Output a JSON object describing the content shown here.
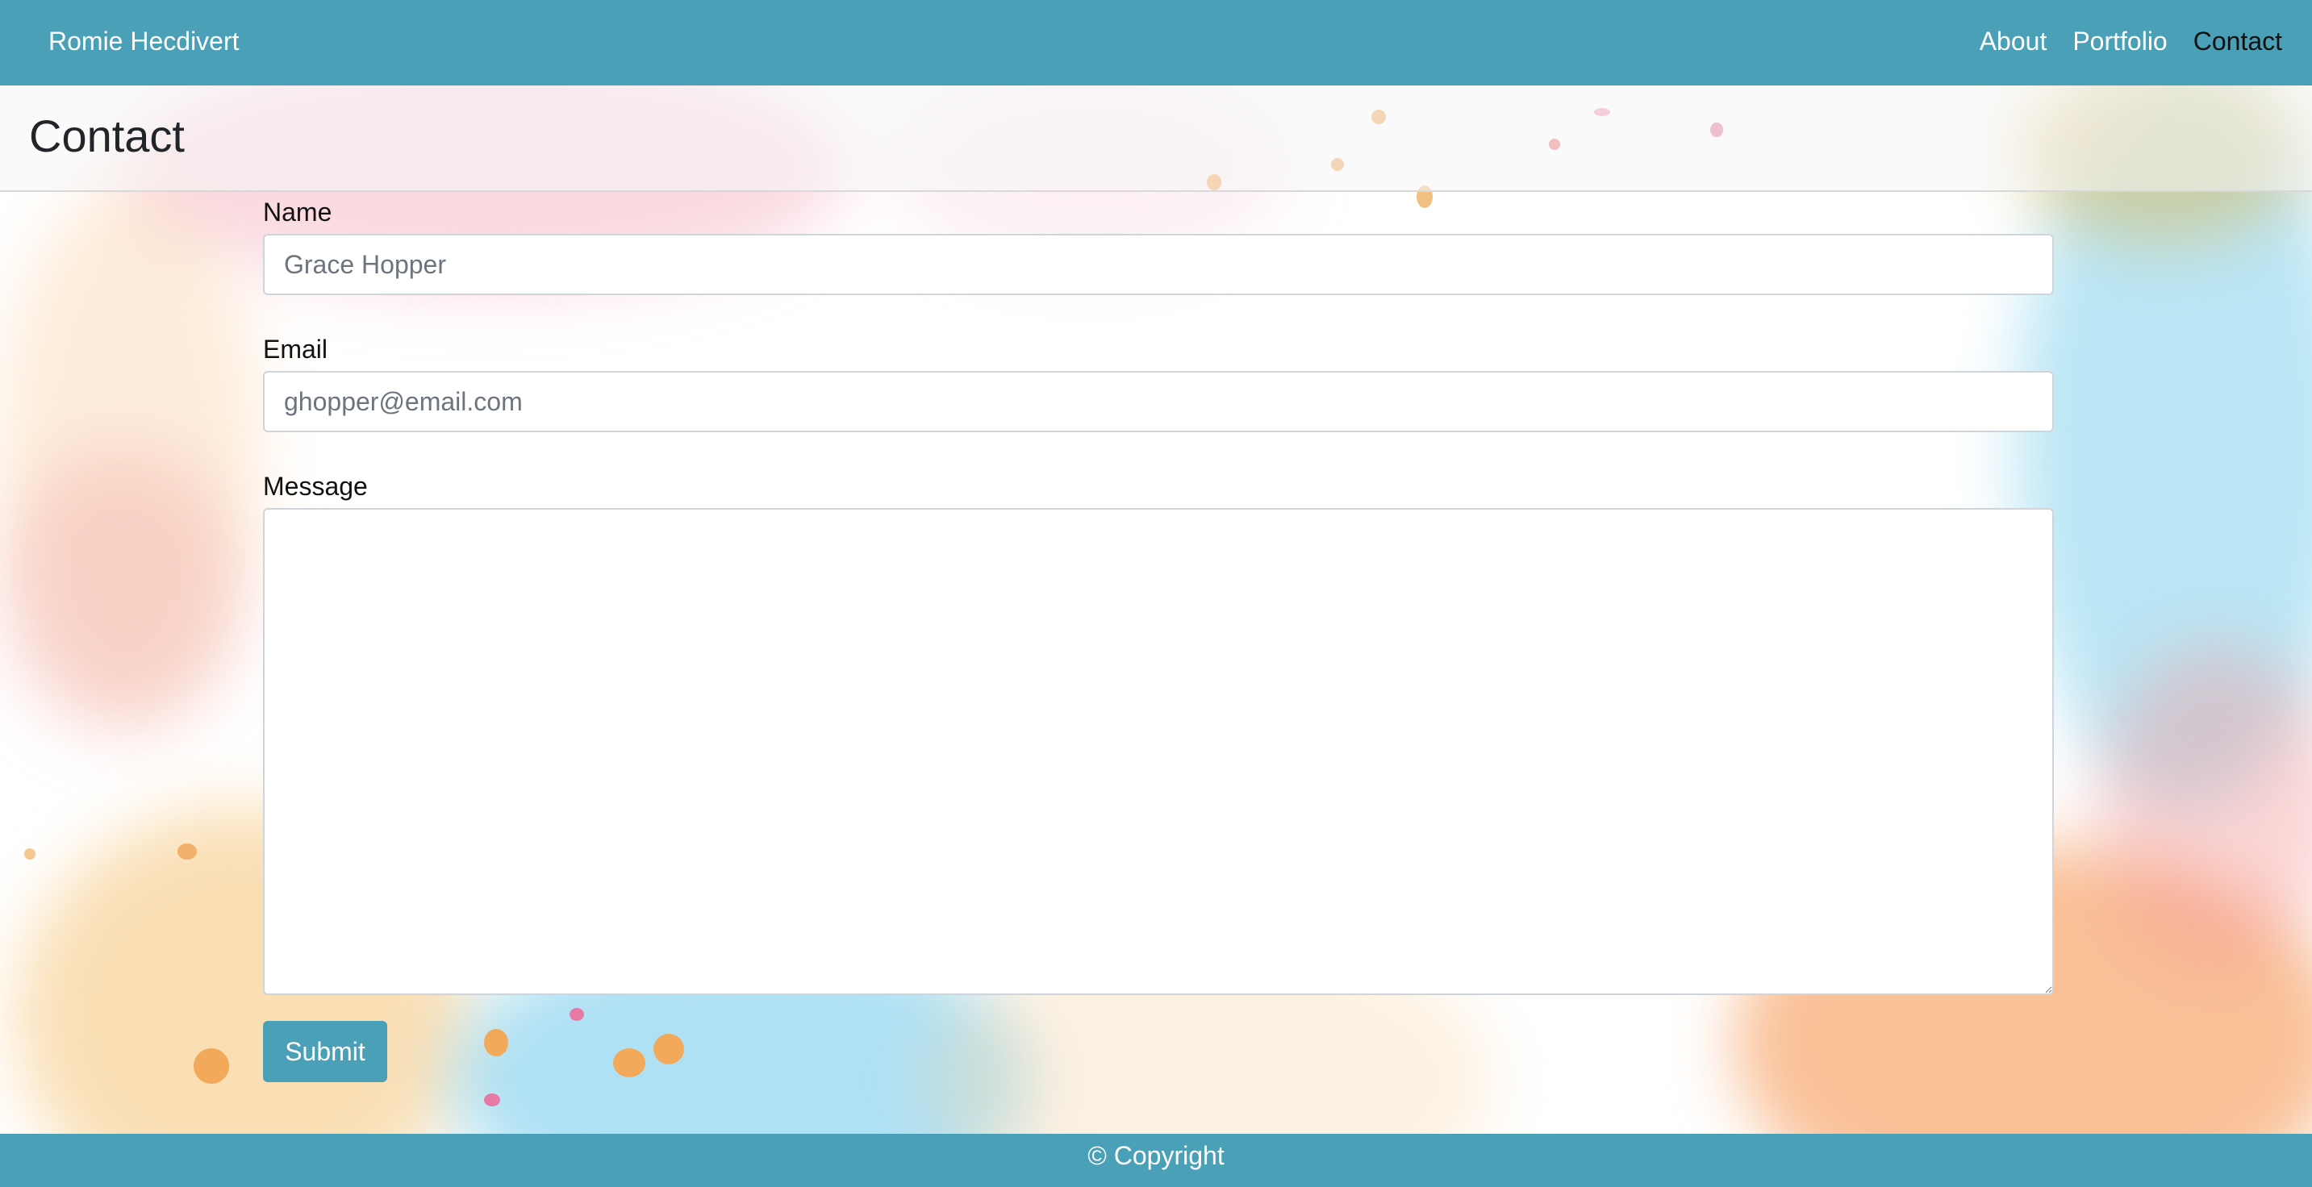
{
  "navbar": {
    "brand": "Romie Hecdivert",
    "links": [
      {
        "label": "About"
      },
      {
        "label": "Portfolio"
      },
      {
        "label": "Contact"
      }
    ],
    "active": "Contact"
  },
  "page": {
    "title": "Contact"
  },
  "form": {
    "name_label": "Name",
    "name_placeholder": "Grace Hopper",
    "name_value": "",
    "email_label": "Email",
    "email_placeholder": "ghopper@email.com",
    "email_value": "",
    "message_label": "Message",
    "message_value": "",
    "submit_label": "Submit"
  },
  "footer": {
    "text": "© Copyright"
  },
  "colors": {
    "primary": "#4aa1b7",
    "active_link": "#111111"
  }
}
